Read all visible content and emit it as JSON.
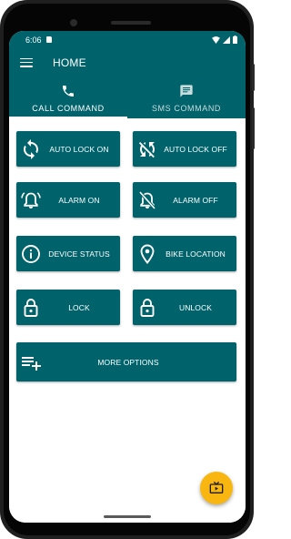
{
  "status_bar": {
    "time": "6:06"
  },
  "app_bar": {
    "title": "HOME"
  },
  "tabs": [
    {
      "label": "CALL COMMAND",
      "icon": "phone-icon",
      "selected": true
    },
    {
      "label": "SMS COMMAND",
      "icon": "sms-icon",
      "selected": false
    }
  ],
  "commands": {
    "auto_lock_on": "AUTO LOCK ON",
    "auto_lock_off": "AUTO LOCK OFF",
    "alarm_on": "ALARM ON",
    "alarm_off": "ALARM OFF",
    "device_status": "DEVICE STATUS",
    "bike_location": "BIKE LOCATION",
    "lock": "LOCK",
    "unlock": "UNLOCK",
    "more_options": "MORE OPTIONS"
  },
  "colors": {
    "primary": "#00626b",
    "accent": "#f9b611",
    "text_on_primary": "#ffffff"
  }
}
